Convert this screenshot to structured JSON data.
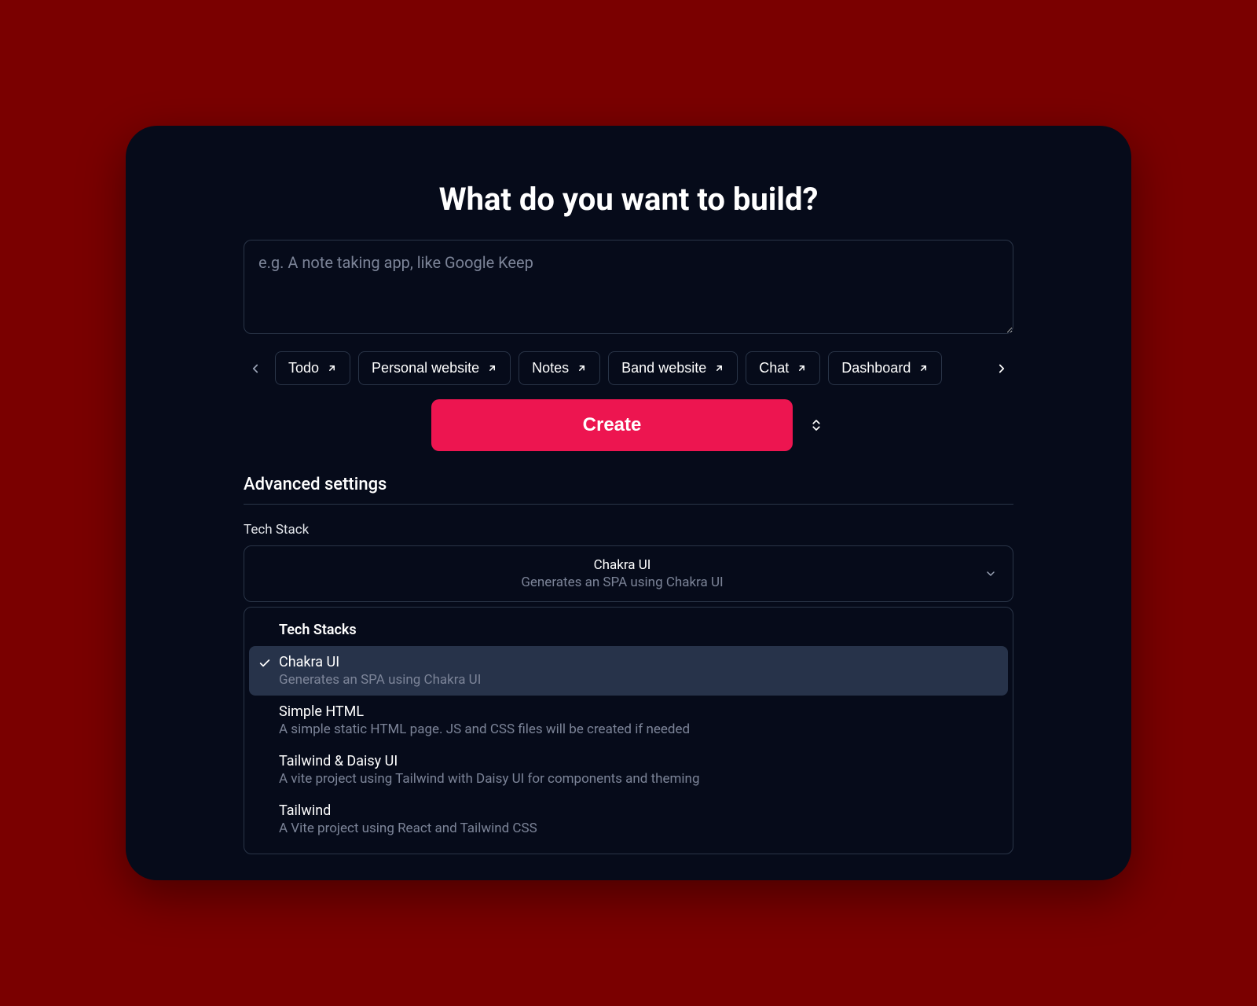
{
  "heading": "What do you want to build?",
  "prompt": {
    "placeholder": "e.g. A note taking app, like Google Keep",
    "value": ""
  },
  "chips": [
    {
      "label": "Todo"
    },
    {
      "label": "Personal website"
    },
    {
      "label": "Notes"
    },
    {
      "label": "Band website"
    },
    {
      "label": "Chat"
    },
    {
      "label": "Dashboard"
    }
  ],
  "create_label": "Create",
  "advanced": {
    "title": "Advanced settings",
    "tech_stack": {
      "label": "Tech Stack",
      "selected_name": "Chakra UI",
      "selected_desc": "Generates an SPA using Chakra UI",
      "group_label": "Tech Stacks",
      "options": [
        {
          "name": "Chakra UI",
          "desc": "Generates an SPA using Chakra UI",
          "selected": true
        },
        {
          "name": "Simple HTML",
          "desc": "A simple static HTML page. JS and CSS files will be created if needed",
          "selected": false
        },
        {
          "name": "Tailwind & Daisy UI",
          "desc": "A vite project using Tailwind with Daisy UI for components and theming",
          "selected": false
        },
        {
          "name": "Tailwind",
          "desc": "A Vite project using React and Tailwind CSS",
          "selected": false
        }
      ]
    }
  }
}
